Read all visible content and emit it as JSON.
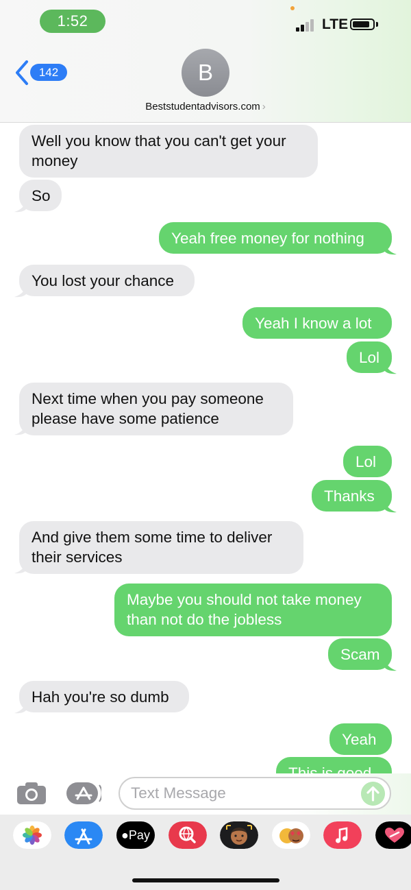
{
  "status_bar": {
    "time": "1:52",
    "network": "LTE"
  },
  "nav": {
    "badge_count": "142",
    "avatar_initial": "B",
    "contact_name": "Beststudentadvisors.com",
    "contact_chevron": "›"
  },
  "messages": [
    {
      "dir": "in",
      "text": "Well you know that you can't get your money"
    },
    {
      "dir": "in",
      "text": "So"
    },
    {
      "dir": "out",
      "text": "Yeah free money for nothing"
    },
    {
      "dir": "in",
      "text": "You lost your chance"
    },
    {
      "dir": "out",
      "text": "Yeah I know a lot"
    },
    {
      "dir": "out",
      "text": "Lol"
    },
    {
      "dir": "in",
      "text": "Next time when you pay someone please have some patience"
    },
    {
      "dir": "out",
      "text": "Lol"
    },
    {
      "dir": "out",
      "text": "Thanks"
    },
    {
      "dir": "in",
      "text": "And give them some time to deliver their services"
    },
    {
      "dir": "out",
      "text": "Maybe you should not take money than not do the jobless"
    },
    {
      "dir": "out",
      "text": "Scam"
    },
    {
      "dir": "in",
      "text": "Hah you're so dumb"
    },
    {
      "dir": "out",
      "text": "Yeah"
    },
    {
      "dir": "out",
      "text": "This is good"
    }
  ],
  "composer": {
    "placeholder": "Text Message"
  },
  "app_drawer": {
    "items": [
      {
        "icon": "photos-icon"
      },
      {
        "icon": "app-store-icon"
      },
      {
        "icon": "apple-pay-icon",
        "label": "Pay"
      },
      {
        "icon": "web-search-icon"
      },
      {
        "icon": "memoji-stickers-icon"
      },
      {
        "icon": "animoji-icon"
      },
      {
        "icon": "music-icon"
      },
      {
        "icon": "digital-touch-icon"
      }
    ]
  },
  "colors": {
    "incoming_bubble": "#e9e9eb",
    "outgoing_bubble": "#65d46e",
    "badge": "#2d7df6",
    "time_pill": "#5cb85c"
  }
}
